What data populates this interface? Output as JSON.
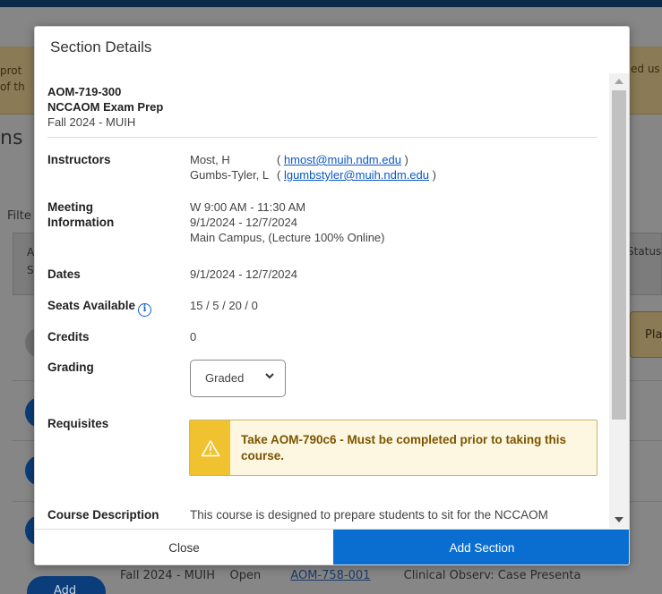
{
  "background": {
    "notice_left_lines": [
      "prot",
      "of th"
    ],
    "notice_right": "ed us",
    "section_heading_fragment": "ns",
    "filter_fragment": "Filte",
    "table_header_fragments": [
      "A",
      "S"
    ],
    "status_header": "Status",
    "plan_button_fragment": "Pla",
    "row": {
      "term": "Fall 2024 - MUIH",
      "status": "Open",
      "section_link": "AOM-758-001",
      "title": "Clinical Observ: Case Presenta"
    },
    "add_button_label": "Add"
  },
  "modal": {
    "title": "Section Details",
    "course_code": "AOM-719-300",
    "course_name": "NCCAOM Exam Prep",
    "term": "Fall 2024 - MUIH",
    "instructors_label": "Instructors",
    "instructors": [
      {
        "name": "Most, H",
        "open": "( ",
        "email": "hmost@muih.ndm.edu",
        "close": " )"
      },
      {
        "name": "Gumbs-Tyler, L",
        "open": "( ",
        "email": "lgumbstyler@muih.ndm.edu",
        "close": " )"
      }
    ],
    "meeting_label_1": "Meeting",
    "meeting_label_2": "Information",
    "meeting_time": "W 9:00 AM - 11:30 AM",
    "meeting_dates": "9/1/2024 - 12/7/2024",
    "meeting_location": "Main Campus, (Lecture 100% Online)",
    "dates_label": "Dates",
    "dates_value": "9/1/2024 - 12/7/2024",
    "seats_label": "Seats Available",
    "seats_value": "15 / 5 / 20 / 0",
    "credits_label": "Credits",
    "credits_value": "0",
    "grading_label": "Grading",
    "grading_selected": "Graded",
    "requisites_label": "Requisites",
    "requisite_text": "Take AOM-790c6 - Must be completed prior to taking this course.",
    "description_label": "Course Description",
    "description_text": "This course is designed to prepare students to sit for the NCCAOM",
    "close_label": "Close",
    "add_section_label": "Add Section"
  },
  "colors": {
    "primary_button": "#0a6ed1",
    "link": "#0a58c2",
    "warning_stripe": "#f1c230",
    "warning_bg": "#fdf6e1",
    "warning_text": "#7a5500"
  },
  "icons": {
    "info": "info-circle-icon",
    "warning": "warning-triangle-icon",
    "select_caret": "chevron-down-icon",
    "scroll_up": "scroll-up-arrow-icon",
    "scroll_down": "scroll-down-arrow-icon"
  }
}
